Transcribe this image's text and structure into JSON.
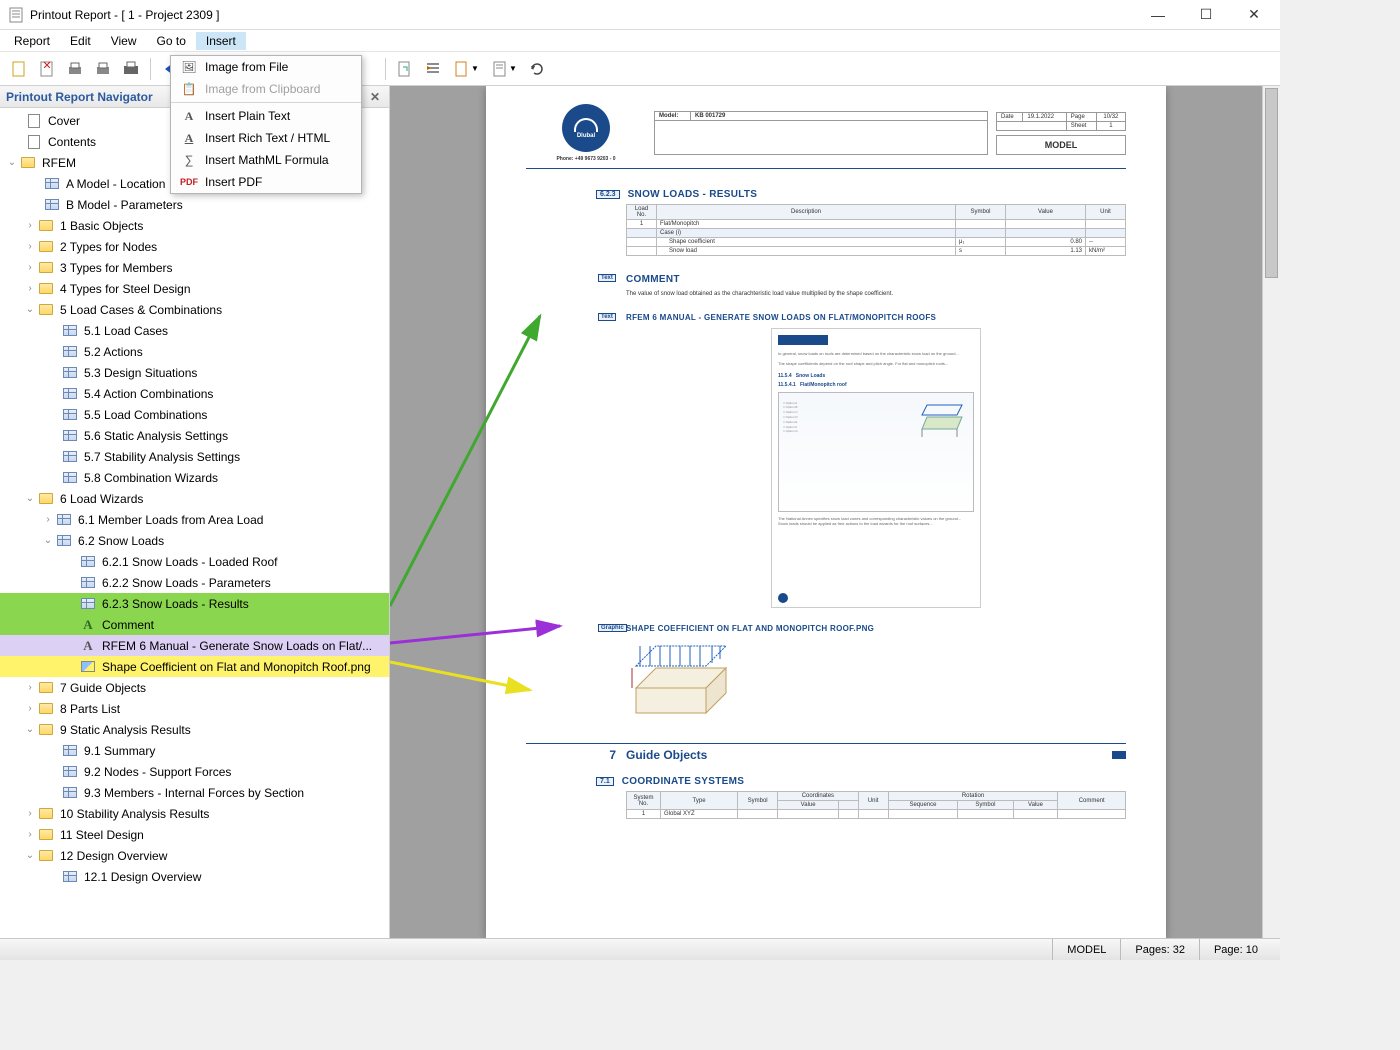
{
  "window": {
    "title": "Printout Report - [ 1 - Project 2309 ]"
  },
  "menubar": {
    "report": "Report",
    "edit": "Edit",
    "view": "View",
    "goto": "Go to",
    "insert": "Insert"
  },
  "insert_menu": {
    "image_file": "Image from File",
    "image_clipboard": "Image from Clipboard",
    "plain_text": "Insert Plain Text",
    "rich_text": "Insert Rich Text / HTML",
    "mathml": "Insert MathML Formula",
    "pdf": "Insert PDF"
  },
  "nav": {
    "title": "Printout Report Navigator",
    "items": {
      "cover": "Cover",
      "contents": "Contents",
      "rfem": "RFEM",
      "a_model": "A Model - Location",
      "b_model": "B Model - Parameters",
      "basic_obj": "1 Basic Objects",
      "types_nodes": "2 Types for Nodes",
      "types_members": "3 Types for Members",
      "types_steel": "4 Types for Steel Design",
      "load_cases": "5 Load Cases & Combinations",
      "lc51": "5.1 Load Cases",
      "lc52": "5.2 Actions",
      "lc53": "5.3 Design Situations",
      "lc54": "5.4 Action Combinations",
      "lc55": "5.5 Load Combinations",
      "lc56": "5.6 Static Analysis Settings",
      "lc57": "5.7 Stability Analysis Settings",
      "lc58": "5.8 Combination Wizards",
      "lw": "6 Load Wizards",
      "lw61": "6.1 Member Loads from Area Load",
      "lw62": "6.2 Snow Loads",
      "lw621": "6.2.1 Snow Loads - Loaded Roof",
      "lw622": "6.2.2 Snow Loads - Parameters",
      "lw623": "6.2.3 Snow Loads - Results",
      "comment": "Comment",
      "manual": "RFEM 6 Manual - Generate Snow Loads on Flat/...",
      "shape": "Shape Coefficient on Flat and Monopitch Roof.png",
      "guide": "7 Guide Objects",
      "parts": "8 Parts List",
      "static": "9 Static Analysis Results",
      "s91": "9.1 Summary",
      "s92": "9.2 Nodes - Support Forces",
      "s93": "9.3 Members - Internal Forces by Section",
      "stab": "10 Stability Analysis Results",
      "steel": "11 Steel Design",
      "design": "12 Design Overview",
      "d121": "12.1 Design Overview"
    }
  },
  "page": {
    "phone": "Phone: +49 9673 9203 - 0",
    "hdr_model_lbl": "Model:",
    "hdr_model_val": "KB 001729",
    "hdr_date_lbl": "Date",
    "hdr_date_val": "19.1.2022",
    "hdr_page_lbl": "Page",
    "hdr_page_val": "10/32",
    "hdr_sheet_lbl": "Sheet",
    "hdr_sheet_val": "1",
    "hdr_model_btn": "MODEL",
    "sec623_num": "6.2.3",
    "sec623_title": "SNOW LOADS - RESULTS",
    "tbl_load_no": "Load\nNo.",
    "tbl_desc": "Description",
    "tbl_symbol": "Symbol",
    "tbl_value": "Value",
    "tbl_unit": "Unit",
    "row1_no": "1",
    "row1_desc": "Flat/Monopitch",
    "row2_desc": "Case (i)",
    "row3_desc": "Shape coefficient",
    "row3_sym": "μ₁",
    "row3_val": "0.80",
    "row3_unit": "--",
    "row4_desc": "Snow load",
    "row4_sym": "s",
    "row4_val": "1.13",
    "row4_unit": "kN/m²",
    "tag_text": "Text",
    "tag_graphic": "Graphic",
    "comment_title": "COMMENT",
    "comment_body": "The value of snow load obtained as the charachteristic load value multiplied by the shape coefficient.",
    "manual_title": "RFEM 6 MANUAL - GENERATE SNOW LOADS ON FLAT/MONOPITCH ROOFS",
    "shape_title": "SHAPE COEFFICIENT ON FLAT AND MONOPITCH ROOF.PNG",
    "sec7_num": "7",
    "sec7_title": "Guide Objects",
    "sec71_num": "7.1",
    "sec71_title": "COORDINATE SYSTEMS",
    "cs_no": "System\nNo.",
    "cs_type": "Type",
    "cs_sym": "Symbol",
    "cs_coords": "Coordinates",
    "cs_val": "Value",
    "cs_unit": "Unit",
    "cs_seq": "Sequence",
    "cs_rot": "Rotation",
    "cs_cmt": "Comment",
    "cs_r1_no": "1",
    "cs_r1_type": "Global XYZ"
  },
  "status": {
    "model": "MODEL",
    "pages": "Pages: 32",
    "page": "Page: 10"
  }
}
